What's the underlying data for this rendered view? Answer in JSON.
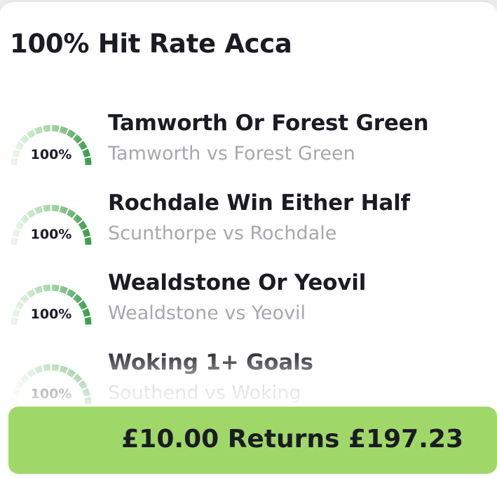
{
  "title": "100% Hit Rate Acca",
  "picks": [
    {
      "market": "Tamworth Or Forest Green",
      "fixture": "Tamworth vs Forest Green",
      "hit_rate": "100%"
    },
    {
      "market": "Rochdale Win Either Half",
      "fixture": "Scunthorpe vs Rochdale",
      "hit_rate": "100%"
    },
    {
      "market": "Wealdstone Or Yeovil",
      "fixture": "Wealdstone vs Yeovil",
      "hit_rate": "100%"
    },
    {
      "market": "Woking 1+ Goals",
      "fixture": "Southend vs Woking",
      "hit_rate": "100%"
    }
  ],
  "bet_bar": {
    "label": "£10.00 Returns £197.23"
  },
  "colors": {
    "gauge_light": "#d3ecd3",
    "gauge_dark": "#3e9e4f",
    "bet_bar_bg": "#9fd868"
  }
}
